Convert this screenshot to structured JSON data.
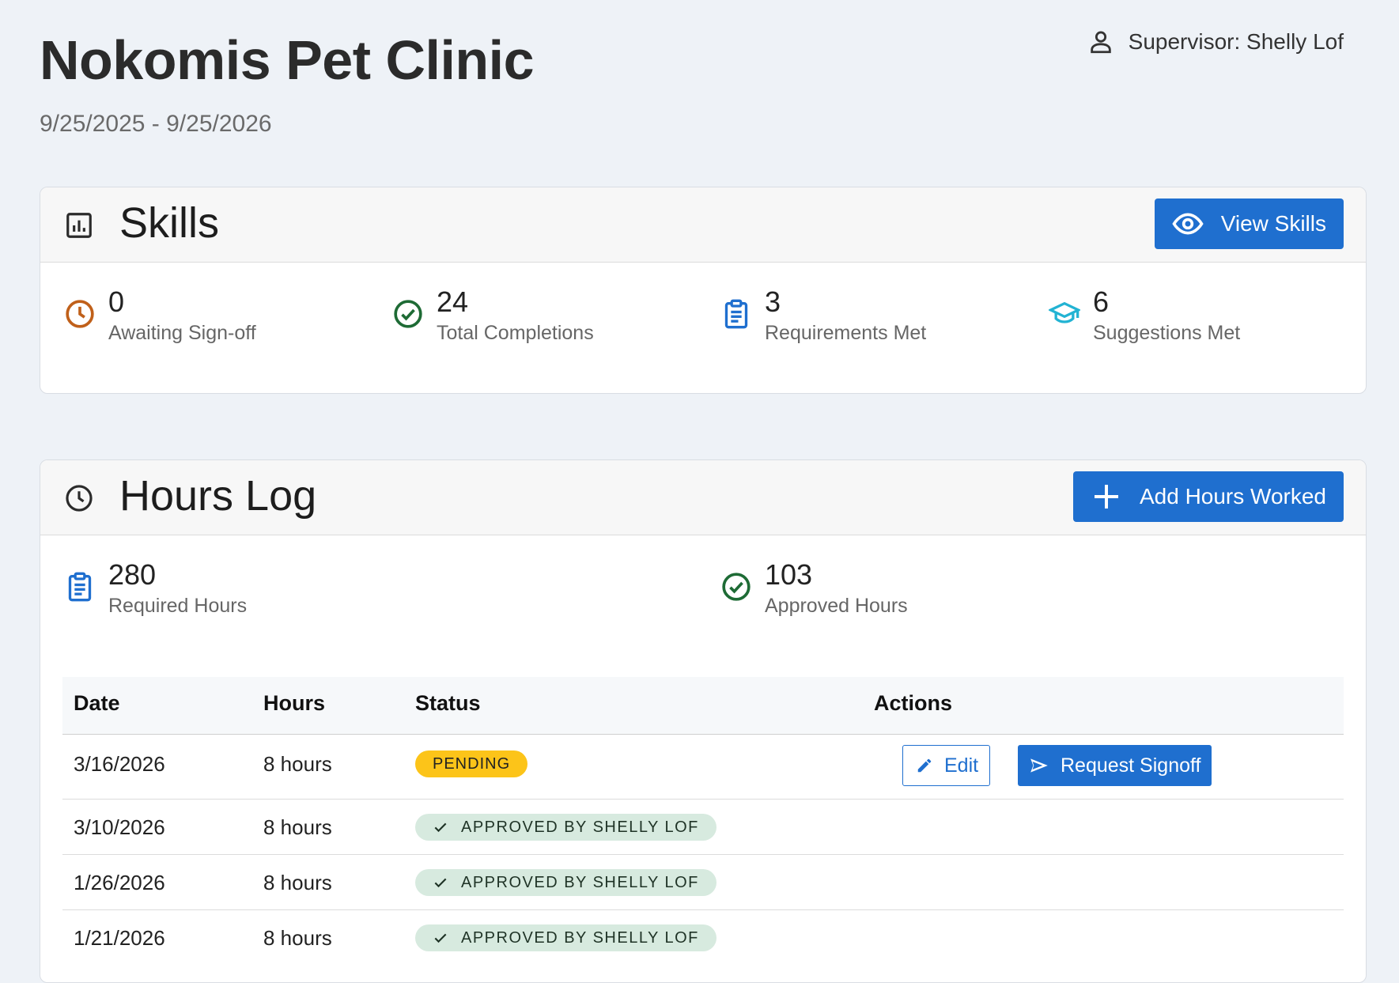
{
  "header": {
    "title": "Nokomis Pet Clinic",
    "date_range": "9/25/2025 - 9/25/2026",
    "supervisor": "Supervisor: Shelly Lof",
    "supervisor_icon": "person-icon"
  },
  "skills": {
    "title": "Skills",
    "icon": "bar-chart-icon",
    "button_label": "View Skills",
    "button_icon": "eye-icon",
    "stats": [
      {
        "value": "0",
        "label": "Awaiting Sign-off",
        "icon": "clock-icon",
        "color": "#c0601a"
      },
      {
        "value": "24",
        "label": "Total Completions",
        "icon": "check-circle-icon",
        "color": "#1e6b35"
      },
      {
        "value": "3",
        "label": "Requirements Met",
        "icon": "clipboard-icon",
        "color": "#1f6fcf"
      },
      {
        "value": "6",
        "label": "Suggestions Met",
        "icon": "graduation-cap-icon",
        "color": "#22b3d3"
      }
    ]
  },
  "hours_log": {
    "title": "Hours Log",
    "icon": "clock-icon",
    "button_label": "Add Hours Worked",
    "button_icon": "plus-icon",
    "stats": [
      {
        "value": "280",
        "label": "Required Hours",
        "icon": "clipboard-icon",
        "color": "#1f6fcf"
      },
      {
        "value": "103",
        "label": "Approved Hours",
        "icon": "check-circle-icon",
        "color": "#1e6b35"
      }
    ],
    "table": {
      "columns": [
        "Date",
        "Hours",
        "Status",
        "Actions"
      ],
      "rows": [
        {
          "date": "3/16/2026",
          "hours": "8 hours",
          "status": "PENDING",
          "edit_label": "Edit",
          "signoff_label": "Request Signoff"
        },
        {
          "date": "3/10/2026",
          "hours": "8 hours",
          "status": "APPROVED BY SHELLY LOF"
        },
        {
          "date": "1/26/2026",
          "hours": "8 hours",
          "status": "APPROVED BY SHELLY LOF"
        },
        {
          "date": "1/21/2026",
          "hours": "8 hours",
          "status": "APPROVED BY SHELLY LOF"
        }
      ]
    }
  },
  "colors": {
    "accent": "#1f6fcf",
    "pending": "#fcc419",
    "approved_bg": "#d7eadf",
    "page_bg": "#eef2f7"
  }
}
